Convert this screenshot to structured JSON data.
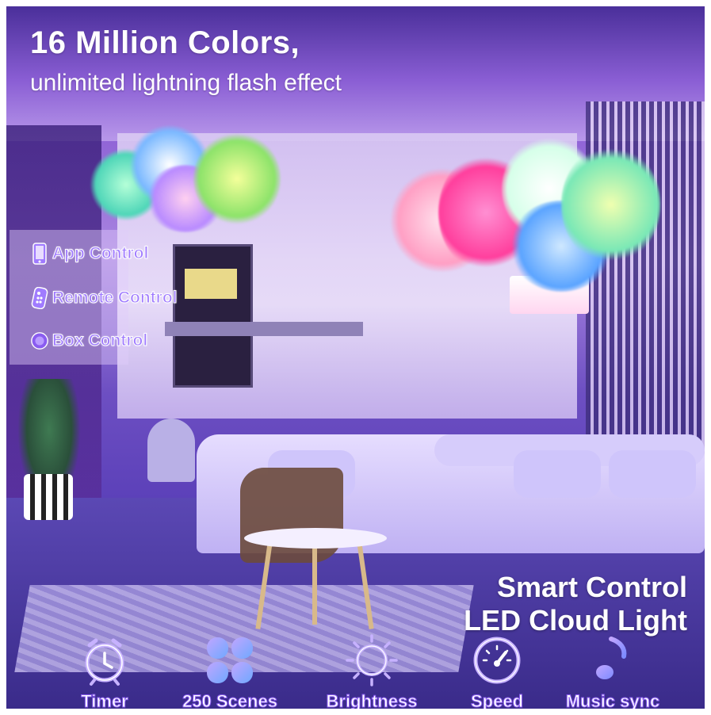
{
  "headline": {
    "title": "16 Million Colors,",
    "subtitle": "unlimited lightning flash effect"
  },
  "controls": [
    {
      "label": "App Control",
      "icon": "smartphone-icon"
    },
    {
      "label": "Remote Control",
      "icon": "remote-icon"
    },
    {
      "label": "Box Control",
      "icon": "box-icon"
    }
  ],
  "tagline": {
    "line1": "Smart Control",
    "line2": "LED Cloud Light"
  },
  "features": [
    {
      "label": "Timer",
      "icon": "alarm-clock-icon"
    },
    {
      "label": "250 Scenes",
      "icon": "scenes-grid-icon"
    },
    {
      "label": "Brightness",
      "icon": "sun-icon"
    },
    {
      "label": "Speed",
      "icon": "speedometer-icon"
    },
    {
      "label": "Music sync",
      "icon": "music-note-icon"
    }
  ],
  "colors": {
    "accent": "#8a5cf0",
    "label_fill": "#a07bff",
    "text": "#ffffff"
  }
}
